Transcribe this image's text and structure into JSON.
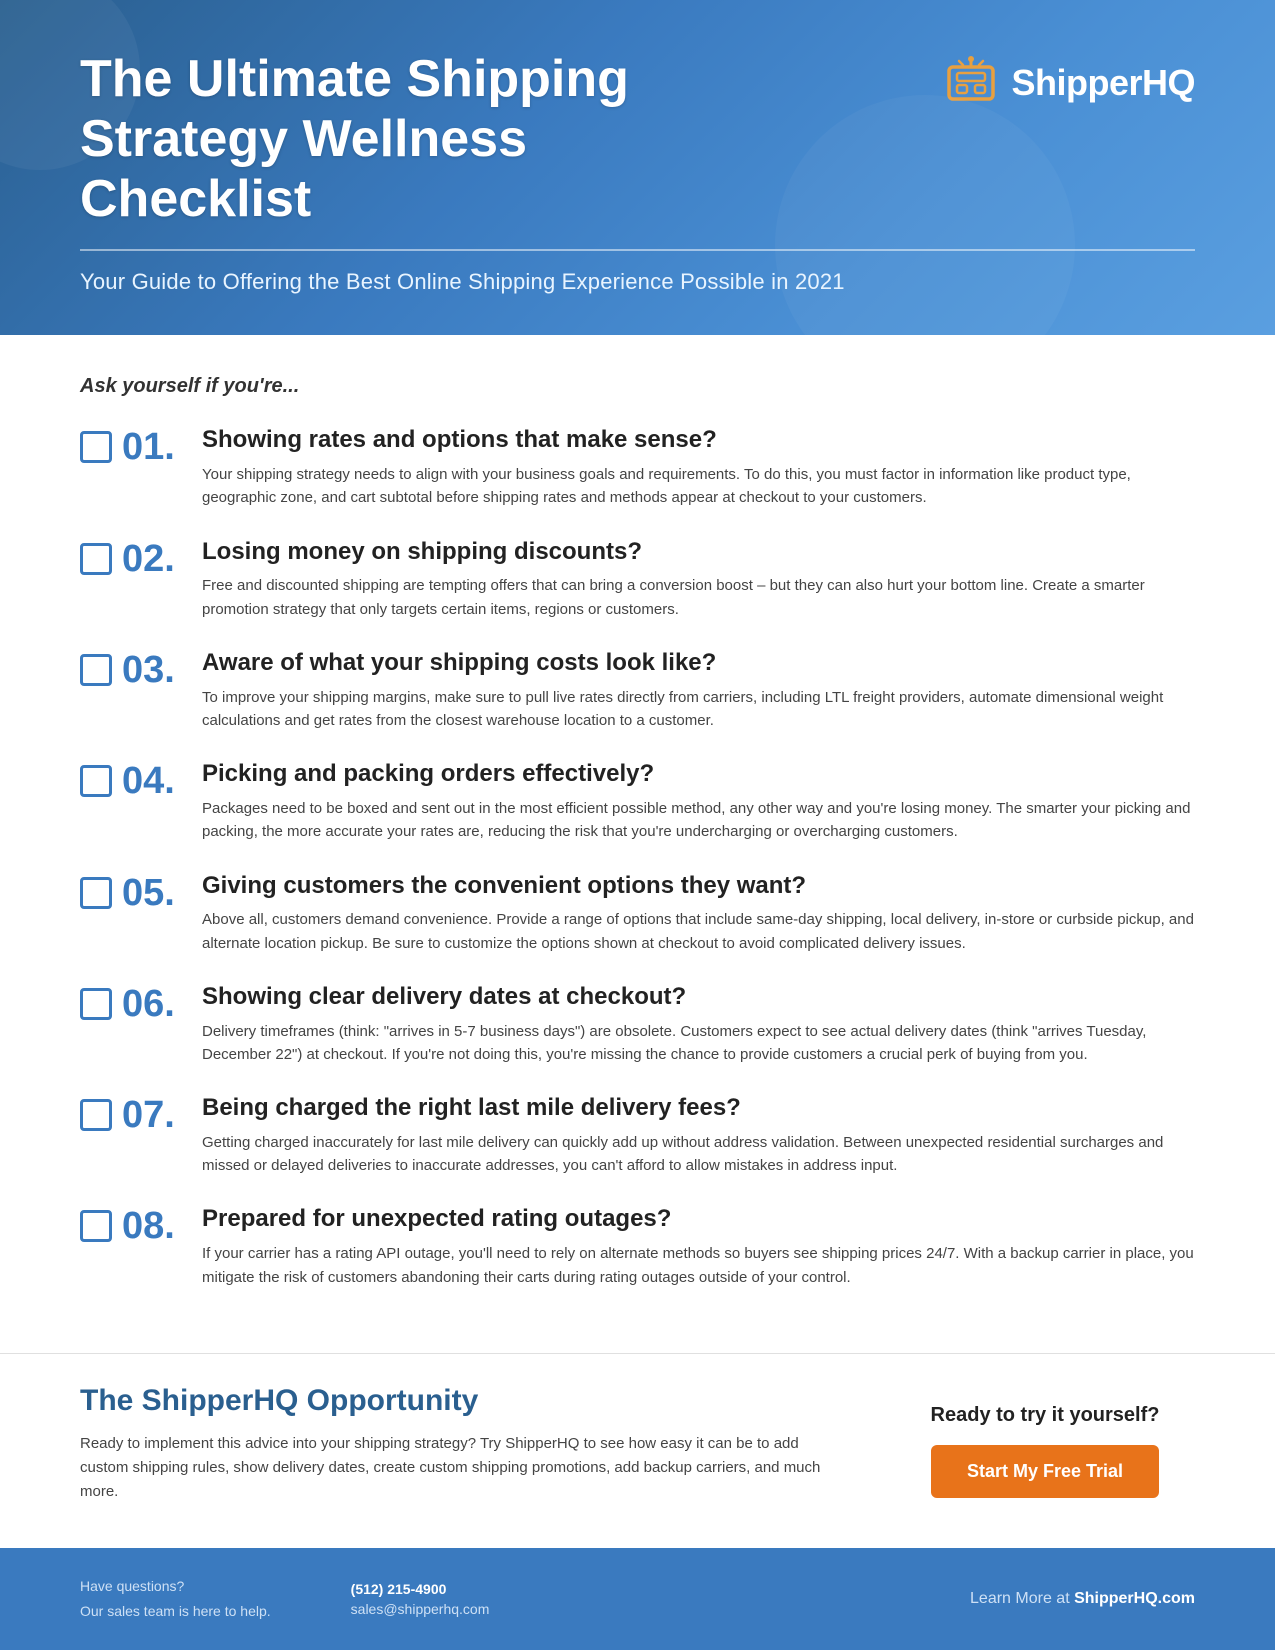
{
  "header": {
    "title": "The Ultimate Shipping Strategy Wellness Checklist",
    "subtitle": "Your Guide to Offering the Best Online Shipping Experience Possible in 2021",
    "logo_text": "ShipperHQ"
  },
  "main": {
    "ask_label": "Ask yourself if you're...",
    "items": [
      {
        "num": "01.",
        "title": "Showing rates and options that make sense?",
        "desc": "Your shipping strategy needs to align with your business goals and requirements. To do this, you must factor in information like product type, geographic zone, and cart subtotal before shipping rates and methods appear at checkout to your customers."
      },
      {
        "num": "02.",
        "title": "Losing money on shipping discounts?",
        "desc": "Free and discounted shipping are tempting offers that can bring a conversion boost – but they can also hurt your bottom line. Create a smarter promotion strategy that only targets certain items, regions or customers."
      },
      {
        "num": "03.",
        "title": "Aware of what your shipping costs look like?",
        "desc": "To improve your shipping margins, make sure to pull live rates directly from carriers, including LTL freight providers, automate dimensional weight calculations and get rates from the closest warehouse location to a customer."
      },
      {
        "num": "04.",
        "title": "Picking and packing orders effectively?",
        "desc": "Packages need to be boxed and sent out in the most efficient possible method, any other way and you're losing money. The smarter your picking and packing, the more accurate your rates are, reducing the risk that you're undercharging or overcharging customers."
      },
      {
        "num": "05.",
        "title": "Giving customers the convenient options they want?",
        "desc": "Above all, customers demand convenience. Provide a range of options that include same-day shipping, local delivery, in-store or curbside pickup, and alternate location pickup. Be sure to customize the options shown at checkout to avoid complicated delivery issues."
      },
      {
        "num": "06.",
        "title": "Showing clear delivery dates at checkout?",
        "desc": "Delivery timeframes (think: \"arrives in 5-7 business days\") are obsolete. Customers expect to see actual delivery dates (think \"arrives Tuesday, December 22\") at checkout. If you're not doing this, you're missing the chance to provide customers a crucial perk of buying from you."
      },
      {
        "num": "07.",
        "title": "Being charged the right last mile delivery fees?",
        "desc": "Getting charged inaccurately for last mile delivery can quickly add up without address validation. Between unexpected residential surcharges and missed or delayed deliveries to inaccurate addresses, you can't afford to allow mistakes in address input."
      },
      {
        "num": "08.",
        "title": "Prepared for unexpected rating outages?",
        "desc": "If your carrier has a rating API outage, you'll need to rely on alternate methods so buyers see shipping prices 24/7. With a backup carrier in place, you mitigate the risk of customers abandoning their carts during rating outages outside of your control."
      }
    ]
  },
  "opportunity": {
    "title": "The ShipperHQ Opportunity",
    "desc": "Ready to implement this advice into your shipping strategy? Try ShipperHQ to see how easy it can be to add custom shipping rules, show delivery dates, create custom shipping promotions, add backup carriers, and much more.",
    "ready_label": "Ready to try it yourself?",
    "cta_label": "Start My Free Trial"
  },
  "footer": {
    "contact_line1": "Have questions?",
    "contact_line2": "Our sales team is here to help.",
    "phone": "(512) 215-4900",
    "email": "sales@shipperhq.com",
    "learn_more": "Learn More at ",
    "learn_more_brand": "ShipperHQ.com"
  }
}
